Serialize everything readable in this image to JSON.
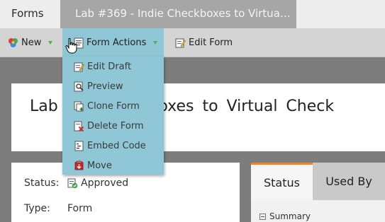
{
  "tabs": {
    "forms_label": "Forms",
    "active_label": "Lab #369 - Indie Checkboxes to Virtua…"
  },
  "toolbar": {
    "new_label": "New",
    "form_actions_label": "Form Actions",
    "edit_form_label": "Edit Form"
  },
  "menu": {
    "items": [
      {
        "label": "Edit Draft",
        "icon": "edit-draft-icon"
      },
      {
        "label": "Preview",
        "icon": "preview-icon"
      },
      {
        "label": "Clone Form",
        "icon": "clone-form-icon"
      },
      {
        "label": "Delete Form",
        "icon": "delete-form-icon"
      },
      {
        "label": "Embed Code",
        "icon": "embed-code-icon"
      },
      {
        "label": "Move",
        "icon": "move-icon"
      }
    ]
  },
  "title": {
    "left": "Lab",
    "right": "Checkboxes to Virtual Check"
  },
  "info": {
    "status_label": "Status:",
    "status_value": "Approved",
    "type_label": "Type:",
    "type_value": "Form"
  },
  "right_tabs": {
    "status_label": "Status",
    "used_by_label": "Used By",
    "summary_label": "Summary"
  },
  "colors": {
    "menu_bg": "#8fc7d6",
    "active_tab_accent": "#f5821f",
    "caret": "#4caf50"
  }
}
